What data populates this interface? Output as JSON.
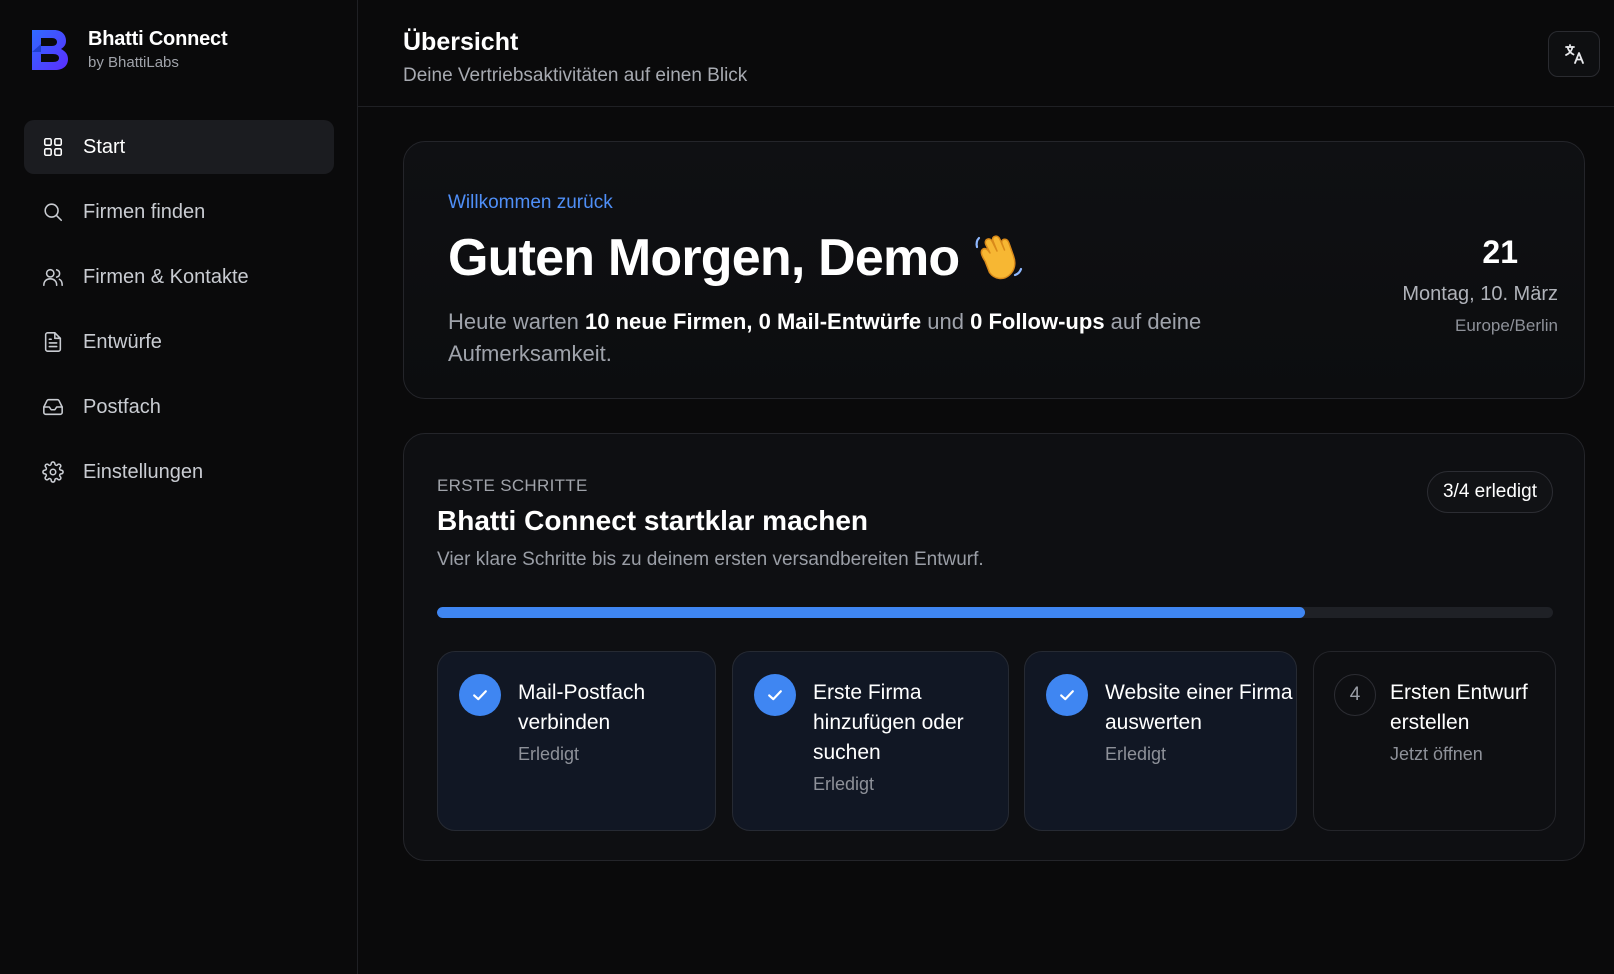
{
  "brand": {
    "name": "Bhatti Connect",
    "sub": "by BhattiLabs",
    "logo_color": "#3b5cff"
  },
  "nav": {
    "items": [
      {
        "label": "Start",
        "icon": "grid-icon",
        "active": true
      },
      {
        "label": "Firmen finden",
        "icon": "search-icon"
      },
      {
        "label": "Firmen & Kontakte",
        "icon": "users-icon"
      },
      {
        "label": "Entwürfe",
        "icon": "document-icon"
      },
      {
        "label": "Postfach",
        "icon": "inbox-icon"
      },
      {
        "label": "Einstellungen",
        "icon": "gear-icon"
      }
    ]
  },
  "header": {
    "title": "Übersicht",
    "subtitle": "Deine Vertriebsaktivitäten auf einen Blick",
    "lang_icon": "translate-icon"
  },
  "welcome": {
    "eyebrow": "Willkommen zurück",
    "title": "Guten Morgen, Demo",
    "emoji_icon": "waving-hand-icon",
    "text_pre": "Heute warten ",
    "new_companies": "10 neue Firmen",
    "sep1": ", ",
    "drafts": "0 Mail-Entwürfe",
    "sep2": " und ",
    "followups": "0 Follow-ups",
    "text_post": " auf deine Aufmerksamkeit.",
    "day": "21",
    "date": "Montag, 10. März",
    "timezone": "Europe/Berlin"
  },
  "onboarding": {
    "eyebrow": "ERSTE SCHRITTE",
    "title": "Bhatti Connect startklar machen",
    "description": "Vier klare Schritte bis zu deinem ersten versandbereiten Entwurf.",
    "badge": "3/4 erledigt",
    "progress_fraction": 0.778,
    "accent_color": "#3f86f2",
    "steps": [
      {
        "line1": "Mail-Postfach",
        "line2": "verbinden",
        "line3": "",
        "status": "Erledigt",
        "done": true
      },
      {
        "line1": "Erste Firma",
        "line2": "hinzufügen oder",
        "line3": "suchen",
        "status": "Erledigt",
        "done": true
      },
      {
        "line1": "Website einer Firma",
        "line2": "auswerten",
        "line3": "",
        "status": "Erledigt",
        "done": true
      },
      {
        "number": "4",
        "line1": "Ersten Entwurf",
        "line2": "erstellen",
        "line3": "",
        "status": "Jetzt öffnen",
        "done": false
      }
    ]
  }
}
